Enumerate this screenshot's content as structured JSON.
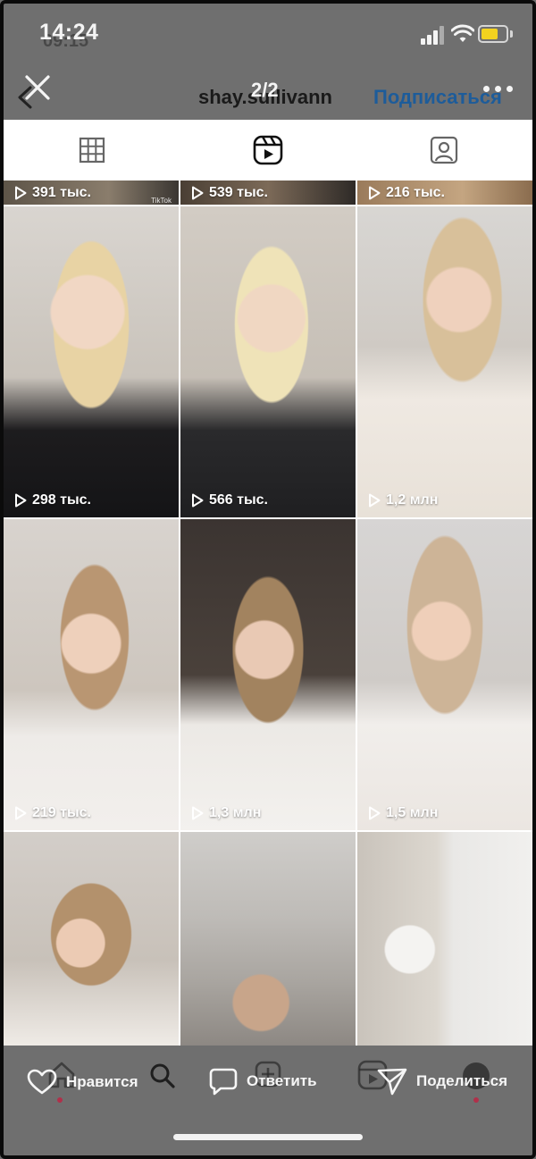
{
  "status_bar": {
    "time": "14:24",
    "time_ghost": "09:15"
  },
  "header": {
    "username": "shay.sullivann",
    "counter": "2/2",
    "follow_label": "Подписаться"
  },
  "tabs": [
    {
      "icon": "grid-icon",
      "active": false
    },
    {
      "icon": "reels-icon",
      "active": true
    },
    {
      "icon": "tagged-icon",
      "active": false
    }
  ],
  "grid": {
    "top_row_views": [
      "391 тыс.",
      "539 тыс.",
      "216 тыс."
    ],
    "tiktok_mark": "TikTok",
    "rows": [
      [
        "298 тыс.",
        "566 тыс.",
        "1,2 млн"
      ],
      [
        "219 тыс.",
        "1,3 млн",
        "1,5 млн"
      ],
      [
        "",
        "",
        ""
      ]
    ]
  },
  "bottom_bar": {
    "like_label": "Нравится",
    "reply_label": "Ответить",
    "share_label": "Поделиться"
  },
  "colors": {
    "follow": "#1d5c9a",
    "battery": "#f2d21f",
    "overlay": "#6f6f6f"
  }
}
